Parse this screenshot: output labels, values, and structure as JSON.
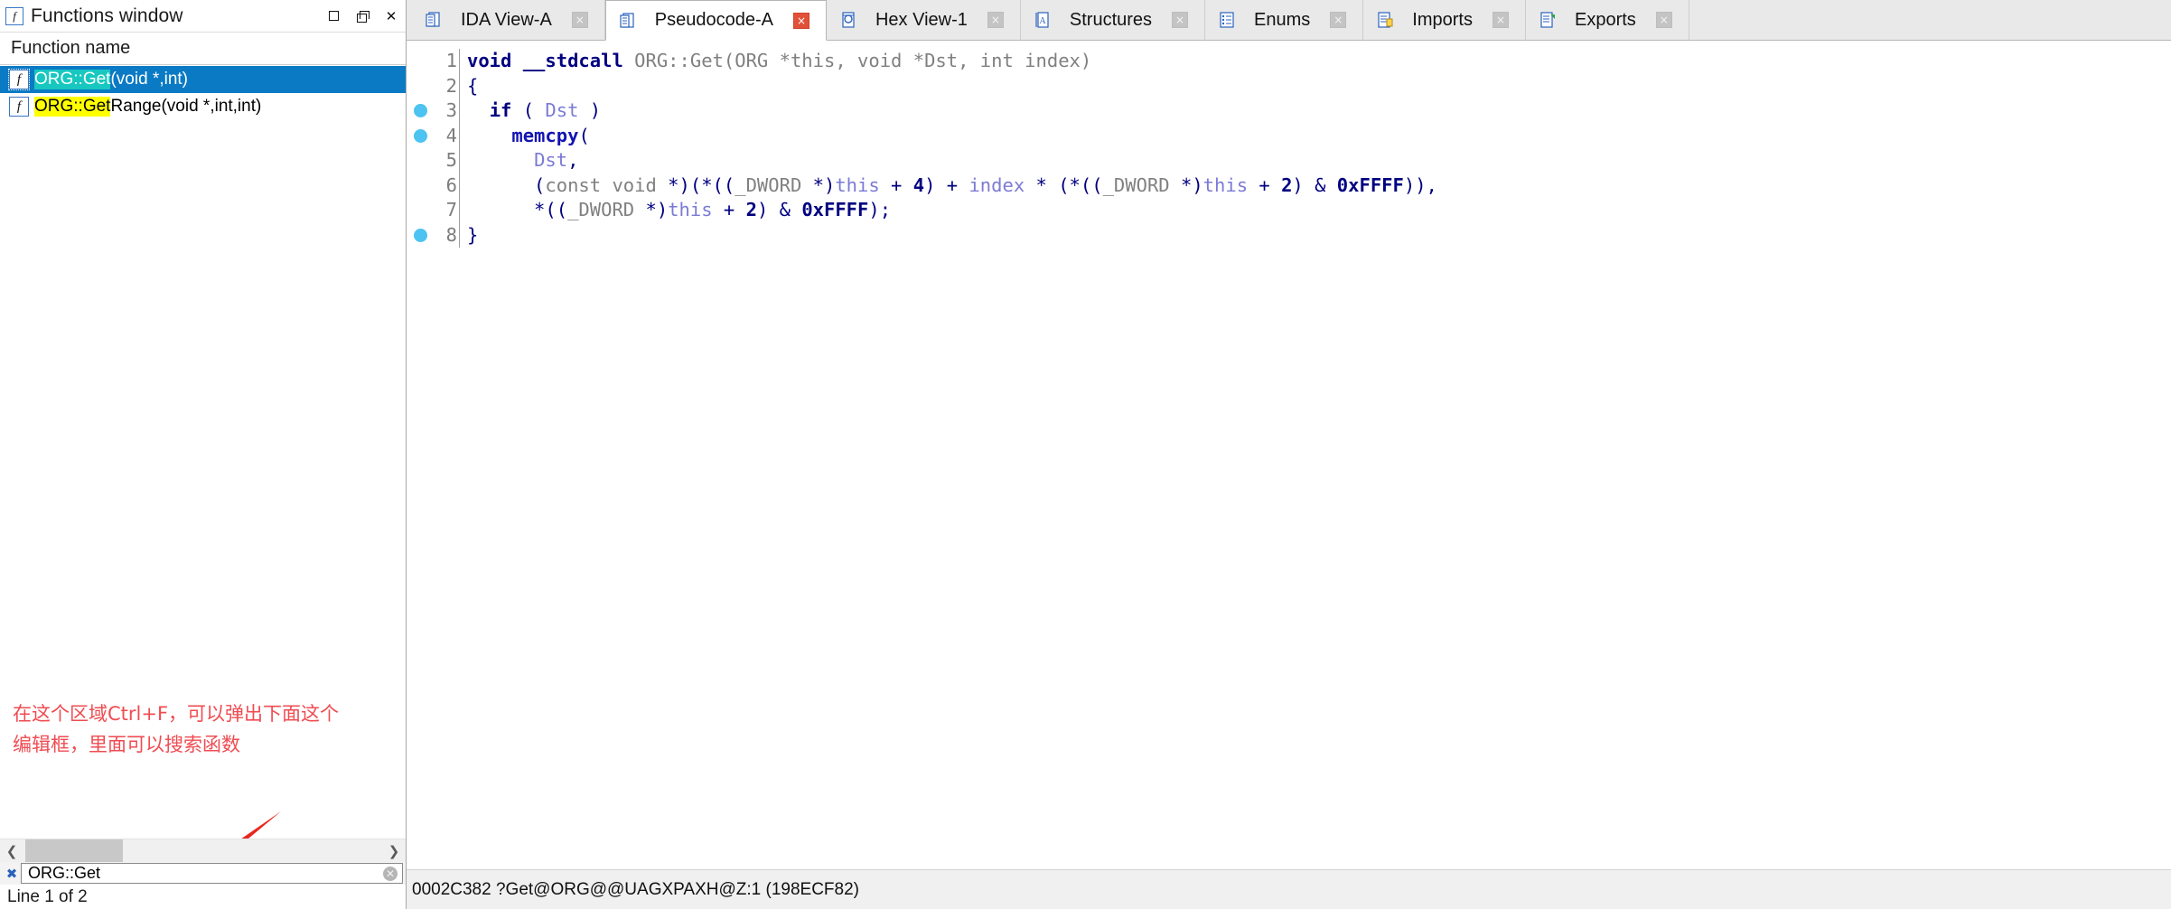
{
  "functions_window": {
    "title": "Functions window",
    "title_icon": "function-f-icon",
    "window_buttons": {
      "maximize": "maximize-icon",
      "restore": "restore-icon",
      "close": "close-icon"
    },
    "column_header": "Function name",
    "items": [
      {
        "icon": "function-f-icon",
        "match": "ORG::Get",
        "rest": "(void *,int)",
        "selected": true,
        "match_highlight": "#18c8c0"
      },
      {
        "icon": "function-f-icon",
        "match": "ORG::Get",
        "rest": "Range(void *,int,int)",
        "selected": false,
        "match_highlight": "#ffff00"
      }
    ],
    "annotation": "在这个区域Ctrl+F，可以弹出下面这个\n编辑框，里面可以搜索函数",
    "annotation_color": "#ef4c52",
    "arrow_color": "#e8271e",
    "hscroll": {
      "left_arrow": "chevron-left-icon",
      "right_arrow": "chevron-right-icon"
    },
    "search": {
      "close_icon": "close-search-icon",
      "value": "ORG::Get",
      "placeholder": "",
      "clear_icon": "clear-icon"
    },
    "status": "Line 1 of 2"
  },
  "main": {
    "tabs": [
      {
        "label": "IDA View-A",
        "icon": "document-view-icon",
        "active": false,
        "close": "×"
      },
      {
        "label": "Pseudocode-A",
        "icon": "document-view-icon",
        "active": true,
        "close": "×"
      },
      {
        "label": "Hex View-1",
        "icon": "hex-view-icon",
        "active": false,
        "close": "×"
      },
      {
        "label": "Structures",
        "icon": "structures-icon",
        "active": false,
        "close": "×"
      },
      {
        "label": "Enums",
        "icon": "enums-icon",
        "active": false,
        "close": "×"
      },
      {
        "label": "Imports",
        "icon": "imports-icon",
        "active": false,
        "close": "×"
      },
      {
        "label": "Exports",
        "icon": "exports-icon",
        "active": false,
        "close": "×"
      }
    ],
    "code": {
      "lines": [
        {
          "num": "1",
          "breakpoint": false,
          "tokens": [
            {
              "t": "void ",
              "c": "c-kw"
            },
            {
              "t": "__stdcall ",
              "c": "c-kw"
            },
            {
              "t": "ORG::Get(",
              "c": "c-type"
            },
            {
              "t": "ORG ",
              "c": "c-type"
            },
            {
              "t": "*this, ",
              "c": "c-type"
            },
            {
              "t": "void ",
              "c": "c-type"
            },
            {
              "t": "*Dst, ",
              "c": "c-type"
            },
            {
              "t": "int ",
              "c": "c-type"
            },
            {
              "t": "index)",
              "c": "c-type"
            }
          ]
        },
        {
          "num": "2",
          "breakpoint": false,
          "tokens": [
            {
              "t": "{",
              "c": "c-punct"
            }
          ]
        },
        {
          "num": "3",
          "breakpoint": true,
          "tokens": [
            {
              "t": "  ",
              "c": "c-plain"
            },
            {
              "t": "if",
              "c": "c-kw"
            },
            {
              "t": " ( ",
              "c": "c-punct"
            },
            {
              "t": "Dst",
              "c": "c-var"
            },
            {
              "t": " )",
              "c": "c-punct"
            }
          ]
        },
        {
          "num": "4",
          "breakpoint": true,
          "tokens": [
            {
              "t": "    ",
              "c": "c-plain"
            },
            {
              "t": "memcpy",
              "c": "c-fn"
            },
            {
              "t": "(",
              "c": "c-punct"
            }
          ]
        },
        {
          "num": "5",
          "breakpoint": false,
          "tokens": [
            {
              "t": "      ",
              "c": "c-plain"
            },
            {
              "t": "Dst",
              "c": "c-var"
            },
            {
              "t": ",",
              "c": "c-punct"
            }
          ]
        },
        {
          "num": "6",
          "breakpoint": false,
          "tokens": [
            {
              "t": "      (",
              "c": "c-punct"
            },
            {
              "t": "const void ",
              "c": "c-type"
            },
            {
              "t": "*)(*((",
              "c": "c-punct"
            },
            {
              "t": "_DWORD ",
              "c": "c-type"
            },
            {
              "t": "*)",
              "c": "c-punct"
            },
            {
              "t": "this",
              "c": "c-var"
            },
            {
              "t": " + ",
              "c": "c-punct"
            },
            {
              "t": "4",
              "c": "c-num"
            },
            {
              "t": ") + ",
              "c": "c-punct"
            },
            {
              "t": "index",
              "c": "c-var"
            },
            {
              "t": " * (*((",
              "c": "c-punct"
            },
            {
              "t": "_DWORD ",
              "c": "c-type"
            },
            {
              "t": "*)",
              "c": "c-punct"
            },
            {
              "t": "this",
              "c": "c-var"
            },
            {
              "t": " + ",
              "c": "c-punct"
            },
            {
              "t": "2",
              "c": "c-num"
            },
            {
              "t": ") & ",
              "c": "c-punct"
            },
            {
              "t": "0xFFFF",
              "c": "c-num"
            },
            {
              "t": ")),",
              "c": "c-punct"
            }
          ]
        },
        {
          "num": "7",
          "breakpoint": false,
          "tokens": [
            {
              "t": "      *((",
              "c": "c-punct"
            },
            {
              "t": "_DWORD ",
              "c": "c-type"
            },
            {
              "t": "*)",
              "c": "c-punct"
            },
            {
              "t": "this",
              "c": "c-var"
            },
            {
              "t": " + ",
              "c": "c-punct"
            },
            {
              "t": "2",
              "c": "c-num"
            },
            {
              "t": ") & ",
              "c": "c-punct"
            },
            {
              "t": "0xFFFF",
              "c": "c-num"
            },
            {
              "t": ");",
              "c": "c-punct"
            }
          ]
        },
        {
          "num": "8",
          "breakpoint": true,
          "tokens": [
            {
              "t": "}",
              "c": "c-punct"
            }
          ]
        }
      ]
    },
    "status": "0002C382 ?Get@ORG@@UAGXPAXH@Z:1 (198ECF82)"
  }
}
